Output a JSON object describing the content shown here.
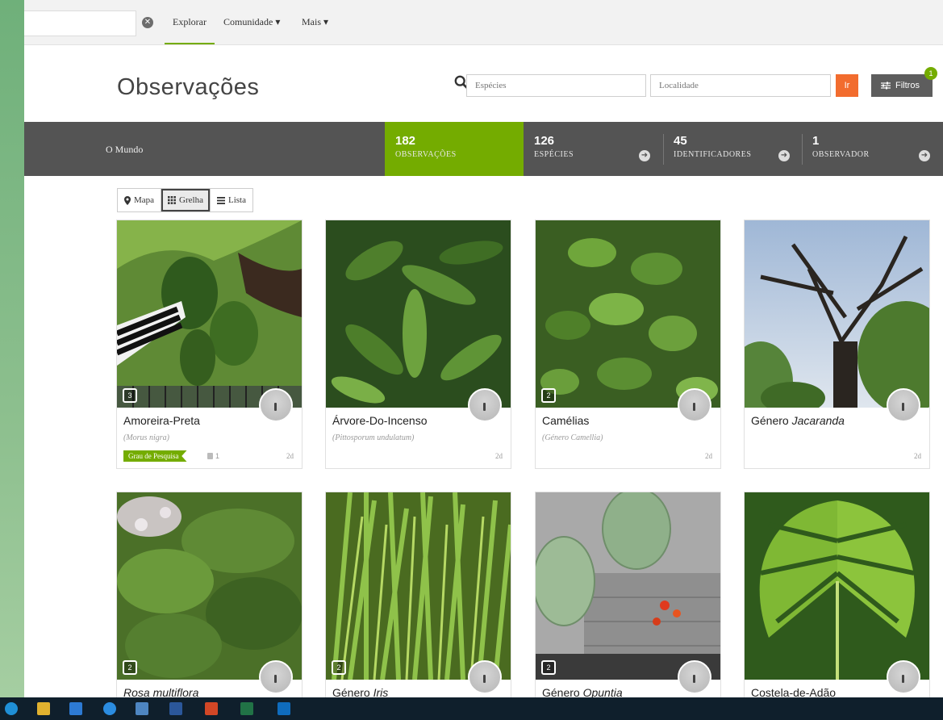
{
  "nav": {
    "search_value": "",
    "items": [
      {
        "label": "Explorar"
      },
      {
        "label": "Comunidade ▾"
      },
      {
        "label": "Mais ▾"
      }
    ]
  },
  "header": {
    "title": "Observações",
    "species_placeholder": "Espécies",
    "location_placeholder": "Localidade",
    "go_label": "Ir",
    "filters_label": "Filtros",
    "filters_badge": "1"
  },
  "stats": {
    "place": "O Mundo",
    "observations": {
      "num": "182",
      "label": "OBSERVAÇÕES"
    },
    "species": {
      "num": "126",
      "label": "ESPÉCIES"
    },
    "identifiers": {
      "num": "45",
      "label": "IDENTIFICADORES"
    },
    "observers": {
      "num": "1",
      "label": "OBSERVADOR"
    }
  },
  "views": [
    {
      "label": "Mapa"
    },
    {
      "label": "Grelha"
    },
    {
      "label": "Lista"
    }
  ],
  "cards": [
    {
      "name": "Amoreira-Preta",
      "sci": "(Morus nigra)",
      "grade": "Grau de Pesquisa",
      "comments": "1",
      "age": "2d",
      "count": "3"
    },
    {
      "name": "Árvore-Do-Incenso",
      "sci": "(Pittosporum undulatum)",
      "age": "2d"
    },
    {
      "name": "Camélias",
      "sci": "(Género Camellia)",
      "age": "2d",
      "count": "2"
    },
    {
      "name_prefix": "Género ",
      "name_italic": "Jacaranda",
      "age": "2d"
    },
    {
      "name_italic": "Rosa multiflora",
      "count": "2"
    },
    {
      "name_prefix": "Género ",
      "name_italic": "Iris",
      "count": "2"
    },
    {
      "name_prefix": "Género ",
      "name_italic": "Opuntia",
      "count": "2"
    },
    {
      "name": "Costela-de-Adão"
    }
  ],
  "colors": {
    "accent": "#74ac00",
    "go": "#f26c2e",
    "statsbar": "#545454"
  }
}
